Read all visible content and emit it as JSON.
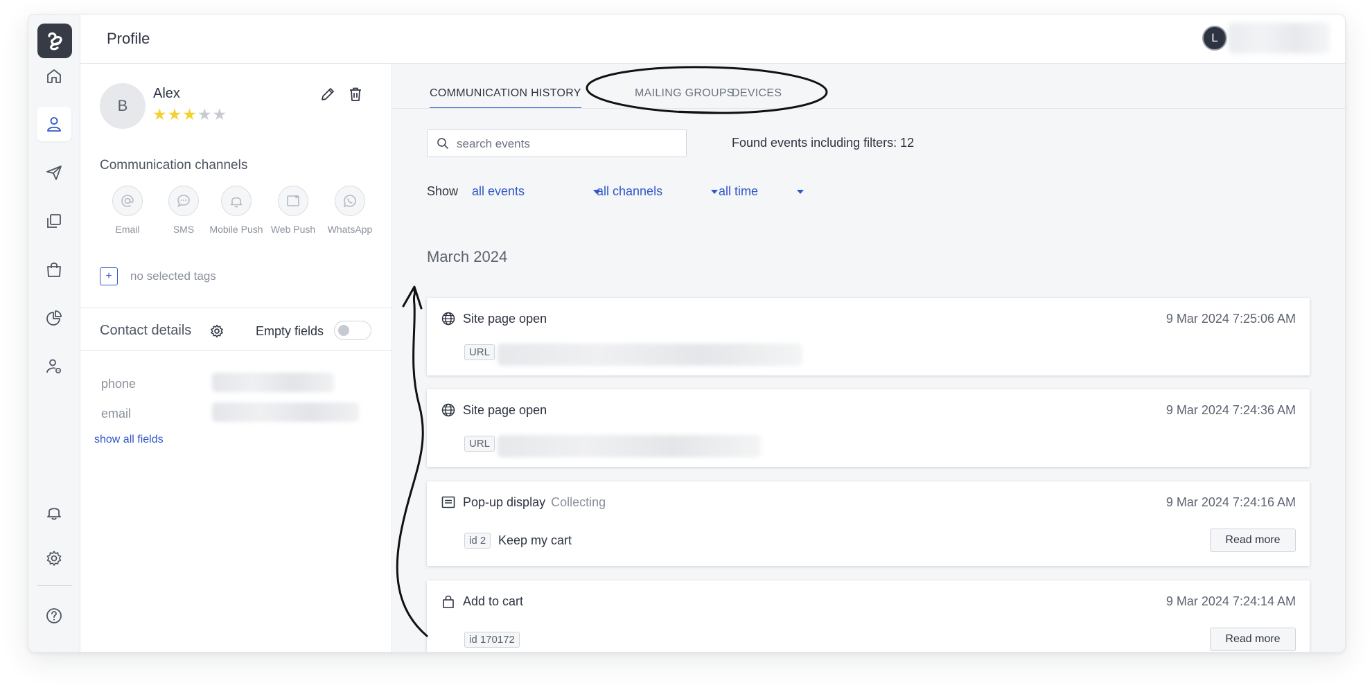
{
  "header": {
    "title": "Profile",
    "user_initial": "L"
  },
  "rail": {
    "items": [
      "home-icon",
      "user-icon",
      "send-icon",
      "copy-icon",
      "shopping-bag-icon",
      "pie-chart-icon",
      "user-settings-icon",
      "bell-icon",
      "gear-icon",
      "help-icon"
    ],
    "active": "user-icon"
  },
  "profile": {
    "avatar_initial": "B",
    "name": "Alex",
    "rating": {
      "value": 3,
      "max": 5
    },
    "channels_title": "Communication channels",
    "channels": [
      {
        "label": "Email",
        "icon": "at-icon"
      },
      {
        "label": "SMS",
        "icon": "chat-icon"
      },
      {
        "label": "Mobile Push",
        "icon": "bell-icon"
      },
      {
        "label": "Web Push",
        "icon": "browser-icon"
      },
      {
        "label": "WhatsApp",
        "icon": "whatsapp-icon"
      }
    ],
    "tags": {
      "add_label": "+",
      "empty_text": "no selected tags"
    },
    "contact": {
      "title": "Contact details",
      "empty_fields_label": "Empty fields",
      "empty_fields_on": false,
      "fields": [
        {
          "label": "phone"
        },
        {
          "label": "email"
        }
      ],
      "show_all_label": "show all fields"
    }
  },
  "main": {
    "tabs": [
      {
        "label": "COMMUNICATION HISTORY",
        "active": true
      },
      {
        "label": "MAILING GROUPS",
        "active": false
      },
      {
        "label": "DEVICES",
        "active": false
      }
    ],
    "search": {
      "placeholder": "search events",
      "value": ""
    },
    "found_text": "Found events including filters: 12",
    "show_label": "Show",
    "filters": {
      "events": "all events",
      "channels": "all channels",
      "time": "all time"
    },
    "month": "March 2024",
    "events": [
      {
        "title": "Site page open",
        "icon": "globe-icon",
        "time": "9 Mar 2024 7:25:06 AM",
        "chip": "URL"
      },
      {
        "title": "Site page open",
        "icon": "globe-icon",
        "time": "9 Mar 2024 7:24:36 AM",
        "chip": "URL"
      },
      {
        "title": "Pop-up display",
        "subtitle": "Collecting",
        "icon": "popup-icon",
        "time": "9 Mar 2024 7:24:16 AM",
        "chip": "id 2",
        "text": "Keep my cart",
        "button": "Read more"
      },
      {
        "title": "Add to cart",
        "icon": "lock-bag-icon",
        "time": "9 Mar 2024 7:24:14 AM",
        "chip": "id 170172",
        "button": "Read more"
      }
    ]
  },
  "colors": {
    "accent": "#2f57c9",
    "star": "#f2d233",
    "dark": "#2d3340"
  }
}
